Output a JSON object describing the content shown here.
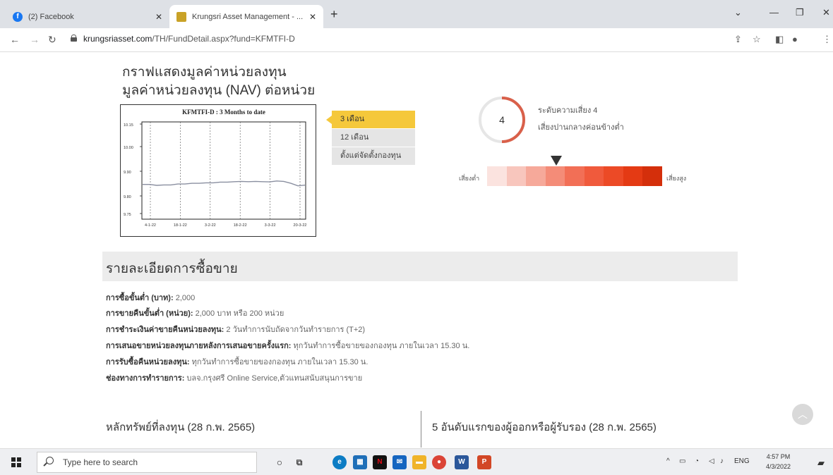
{
  "browser": {
    "tabs": [
      {
        "title": "(2) Facebook"
      },
      {
        "title": "Krungsri Asset Management - ..."
      }
    ],
    "url_host": "krungsriasset.com",
    "url_path": "/TH/FundDetail.aspx?fund=KFMTFI-D"
  },
  "graph": {
    "title_line1": "กราฟแสดงมูลค่าหน่วยลงทุน",
    "title_line2": "มูลค่าหน่วยลงทุน (NAV) ต่อหน่วย",
    "periods": [
      "3 เดือน",
      "12 เดือน",
      "ตั้งแต่จัดตั้งกองทุน"
    ],
    "active_period": "3 เดือน"
  },
  "chart_data": {
    "type": "line",
    "title": "KFMTFI-D : 3 Months to date",
    "x_ticks": [
      "4-1-22",
      "18-1-22",
      "3-2-22",
      "18-2-22",
      "3-3-22",
      "20-3-22"
    ],
    "y_ticks": [
      "10.15",
      "10.00",
      "9.90",
      "9.80",
      "9.75"
    ],
    "series": [
      {
        "values": [
          9.89,
          9.89,
          9.886,
          9.888,
          9.888,
          9.892,
          9.892,
          9.895,
          9.895,
          9.897,
          9.897,
          9.9,
          9.9,
          9.902,
          9.903,
          9.902,
          9.903,
          9.902,
          9.901,
          9.905,
          9.903,
          9.895,
          9.884,
          9.887
        ]
      }
    ],
    "ylim": [
      9.74,
      10.16
    ],
    "grid": true
  },
  "risk": {
    "level": "4",
    "label_line1": "ระดับความเสี่ยง 4",
    "label_line2": "เสี่ยงปานกลางค่อนข้างต่ำ",
    "low_label": "เสี่ยงต่ำ",
    "high_label": "เสี่ยงสูง",
    "segment_colors": [
      "#fbe3df",
      "#f8c6bd",
      "#f6a99a",
      "#f48c78",
      "#f26f56",
      "#f05a3c",
      "#ec4a26",
      "#e43a14",
      "#d42f0b"
    ]
  },
  "trading": {
    "heading": "รายละเอียดการซื้อขาย",
    "rows": [
      {
        "label": "การซื้อขั้นต่ำ (บาท):",
        "value": " 2,000"
      },
      {
        "label": "การขายคืนขั้นต่ำ (หน่วย):",
        "value": " 2,000 บาท หรือ 200 หน่วย"
      },
      {
        "label": "การชำระเงินค่าขายคืนหน่วยลงทุน:",
        "value": " 2 วันทำการนับถัดจากวันทำรายการ (T+2)"
      },
      {
        "label": "การเสนอขายหน่วยลงทุนภายหลังการเสนอขายครั้งแรก:",
        "value": " ทุกวันทำการซื้อขายของกองทุน ภายในเวลา 15.30 น."
      },
      {
        "label": "การรับซื้อคืนหน่วยลงทุน:",
        "value": " ทุกวันทำการซื้อขายของกองทุน ภายในเวลา 15.30 น."
      },
      {
        "label": "ช่องทางการทำรายการ:",
        "value": " บลจ.กรุงศรี Online Service,ตัวแทนสนับสนุนการขาย"
      }
    ]
  },
  "sections": {
    "securities": "หลักทรัพย์ที่ลงทุน (28 ก.พ. 2565)",
    "top5": "5 อันดับแรกของผู้ออกหรือผู้รับรอง (28 ก.พ. 2565)"
  },
  "taskbar": {
    "search_placeholder": "Type here to search",
    "language": "ENG",
    "time": "4:57 PM",
    "date": "4/3/2022"
  }
}
